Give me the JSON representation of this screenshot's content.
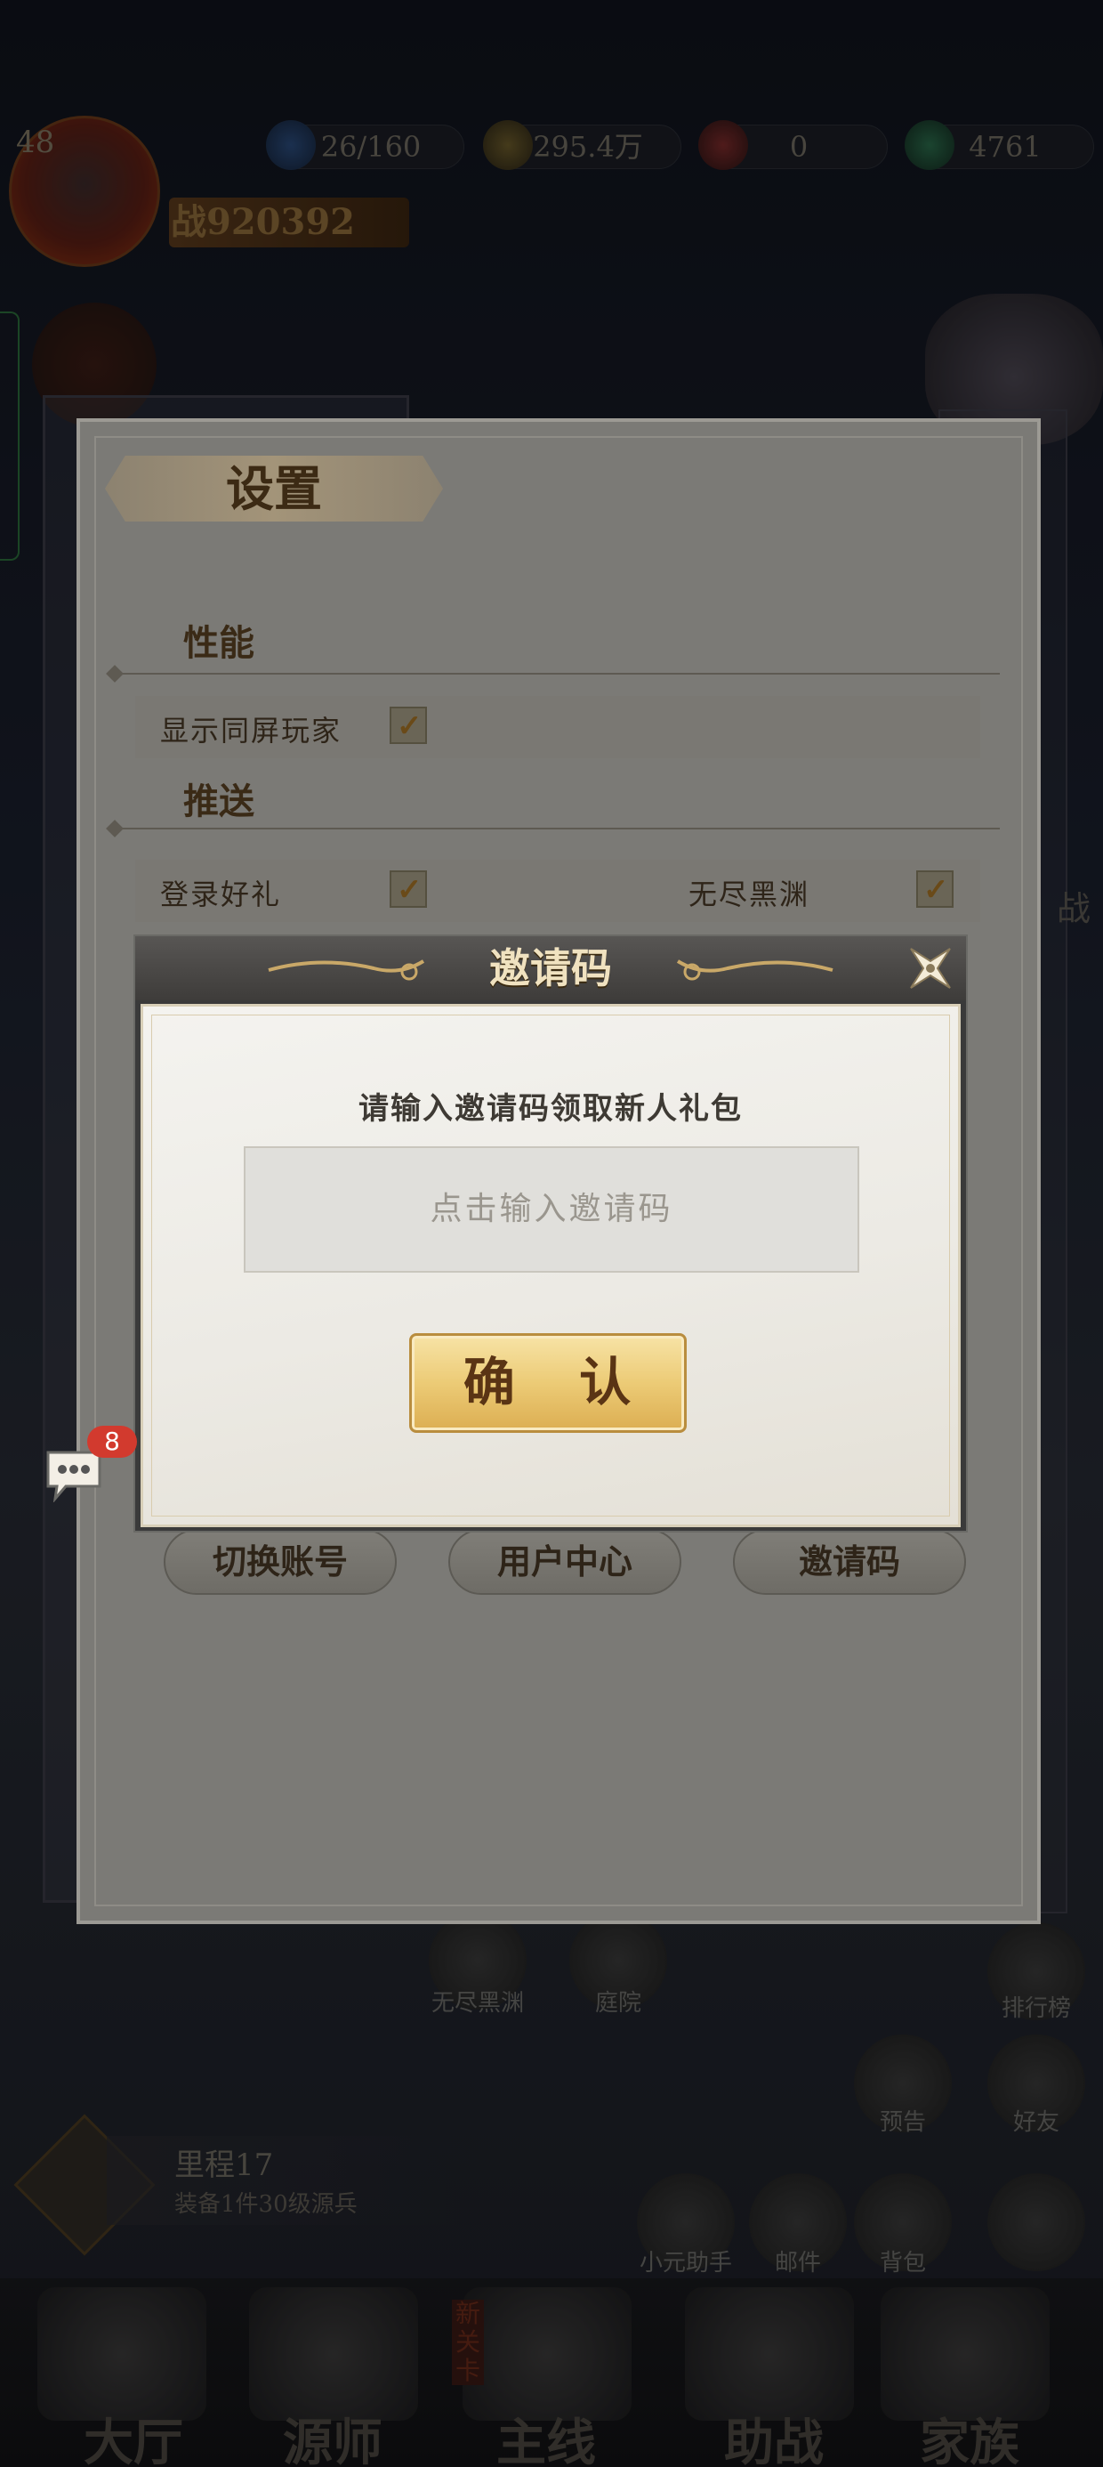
{
  "hud": {
    "level": "48",
    "power": "战920392",
    "resources": [
      {
        "icon": "stamina-icon",
        "value": "26/160"
      },
      {
        "icon": "gold-coin-icon",
        "value": "295.4万"
      },
      {
        "icon": "red-gem-icon",
        "value": "0"
      },
      {
        "icon": "jade-icon",
        "value": "4761"
      }
    ]
  },
  "settings": {
    "title": "设置",
    "performance_heading": "性能",
    "show_players_label": "显示同屏玩家",
    "push_heading": "推送",
    "login_gift_label": "登录好礼",
    "endless_abyss_label": "无尽黑渊",
    "checkmark": "✓",
    "buttons": {
      "switch_account": "切换账号",
      "user_center": "用户中心",
      "invite_code": "邀请码"
    }
  },
  "invite_dialog": {
    "title": "邀请码",
    "prompt": "请输入邀请码领取新人礼包",
    "input_placeholder": "点击输入邀请码",
    "confirm_label": "确 认"
  },
  "chat": {
    "badge_count": "8"
  },
  "background": {
    "side_labels": {
      "right_war": "战"
    },
    "shortcuts": [
      {
        "label": "无尽黑渊"
      },
      {
        "label": "庭院"
      },
      {
        "label": "排行榜"
      },
      {
        "label": "预告"
      },
      {
        "label": "好友"
      },
      {
        "label": "小元助手"
      },
      {
        "label": "邮件"
      },
      {
        "label": "背包"
      }
    ],
    "mission": {
      "title": "里程17",
      "subtitle": "装备1件30级源兵"
    },
    "nav": [
      "大厅",
      "源师",
      "主线",
      "助战",
      "家族"
    ],
    "nav_tag": "新关卡"
  }
}
